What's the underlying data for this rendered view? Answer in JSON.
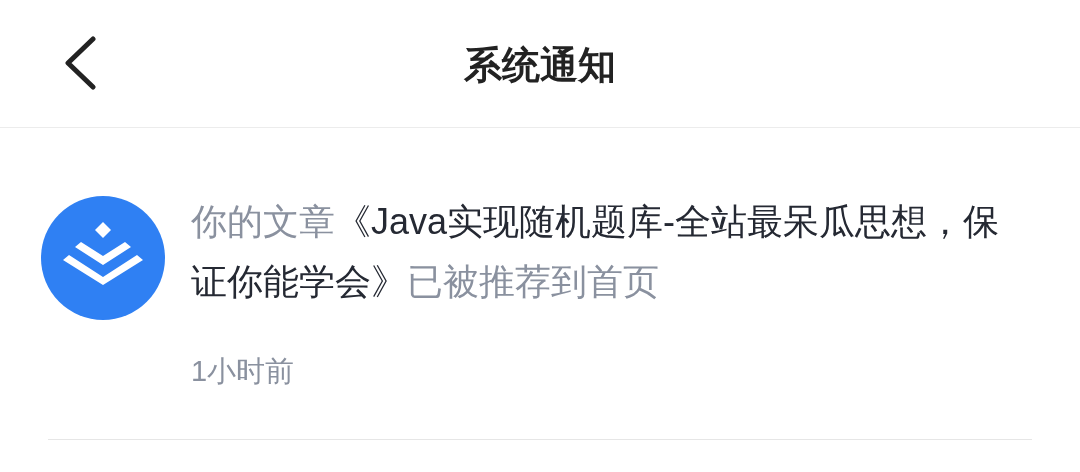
{
  "header": {
    "title": "系统通知"
  },
  "notifications": [
    {
      "message": {
        "prefix": "你的文章",
        "article": "《Java实现随机题库-全站最呆瓜思想，保证你能学会》",
        "suffix": "已被推荐到首页"
      },
      "time": "1小时前"
    }
  ]
}
